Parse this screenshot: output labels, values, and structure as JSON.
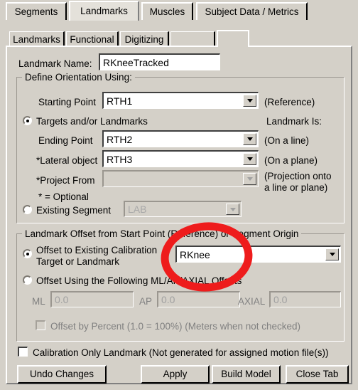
{
  "window": {
    "background_color": "#d4d0c8",
    "annotation_color": "#ee1c1c"
  },
  "outer_tabs": [
    {
      "label": "Segments",
      "selected": false
    },
    {
      "label": "Landmarks",
      "selected": true
    },
    {
      "label": "Muscles",
      "selected": false
    },
    {
      "label": "Subject Data / Metrics",
      "selected": false
    }
  ],
  "inner_tabs": [
    {
      "label": "Landmarks",
      "selected": false
    },
    {
      "label": "Functional",
      "selected": false
    },
    {
      "label": "Digitizing",
      "selected": false
    },
    {
      "label": "",
      "selected": false
    },
    {
      "label": "",
      "selected": true
    }
  ],
  "landmark_name": {
    "label": "Landmark Name:",
    "value": "RKneeTracked"
  },
  "orientation_group": {
    "legend": "Define Orientation Using:",
    "starting_point": {
      "label": "Starting Point",
      "value": "RTH1",
      "note": "(Reference)"
    },
    "targets_radio": {
      "label": "Targets and/or Landmarks",
      "selected": true
    },
    "landmark_is_label": "Landmark Is:",
    "ending_point": {
      "label": "Ending Point",
      "value": "RTH2",
      "note": "(On a line)"
    },
    "lateral_object": {
      "label": "*Lateral object",
      "value": "RTH3",
      "note": "(On a plane)"
    },
    "project_from": {
      "label": "*Project From",
      "value": "",
      "note_line1": "(Projection onto",
      "note_line2": "a line or plane)",
      "disabled": true
    },
    "optional_note": "* = Optional",
    "existing_segment": {
      "label": "Existing Segment",
      "value": "LAB",
      "selected": false,
      "disabled": true
    }
  },
  "offset_group": {
    "legend": "Landmark Offset from Start Point (Reference) or Segment Origin",
    "offset_existing": {
      "label_line1": "Offset to Existing Calibration",
      "label_line2": "Target or Landmark",
      "selected": true,
      "value": "RKnee"
    },
    "offset_mlapaxial": {
      "label": "Offset Using the Following ML/AP/AXIAL Offsets",
      "selected": false
    },
    "ml": {
      "label": "ML",
      "value": "0.0",
      "disabled": true
    },
    "ap": {
      "label": "AP",
      "value": "0.0",
      "disabled": true
    },
    "axial": {
      "label": "AXIAL",
      "value": "0.0",
      "disabled": true
    },
    "offset_percent": {
      "label": "Offset by Percent (1.0 = 100%) (Meters when not checked)",
      "checked": false,
      "disabled": true
    }
  },
  "calibration_only": {
    "label": "Calibration Only Landmark (Not generated for assigned motion file(s))",
    "checked": false
  },
  "buttons": {
    "undo": "Undo Changes",
    "apply": "Apply",
    "build_model": "Build Model",
    "close_tab": "Close Tab"
  }
}
